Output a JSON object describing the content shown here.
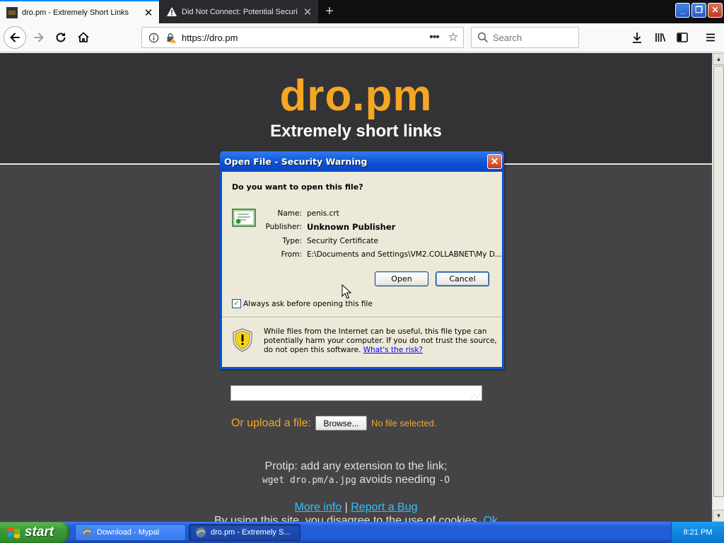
{
  "browser": {
    "tabs": [
      {
        "title": "dro.pm - Extremely Short Links",
        "active": true
      },
      {
        "title": "Did Not Connect: Potential Securi",
        "active": false
      }
    ],
    "url": "https://dro.pm",
    "search_placeholder": "Search"
  },
  "page": {
    "logo": "dro.pm",
    "tagline": "Extremely short links",
    "upload_label": "Or upload a file:",
    "browse_label": "Browse...",
    "no_file": "No file selected.",
    "protip_line1": "Protip: add any extension to the link;",
    "protip_code": "wget dro.pm/a.jpg",
    "protip_mid": " avoids needing ",
    "protip_flag": "-O",
    "more_info": "More info",
    "separator": " | ",
    "report_bug": "Report a Bug",
    "cookie_text": "By using this site, you disagree to the use of cookies. ",
    "cookie_ok": "Ok"
  },
  "dialog": {
    "title": "Open File - Security Warning",
    "question": "Do you want to open this file?",
    "labels": {
      "name": "Name:",
      "publisher": "Publisher:",
      "type": "Type:",
      "from": "From:"
    },
    "values": {
      "name": "penis.crt",
      "publisher": "Unknown Publisher",
      "type": "Security Certificate",
      "from": "E:\\Documents and Settings\\VM2.COLLABNET\\My D..."
    },
    "open_label": "Open",
    "cancel_label": "Cancel",
    "always_ask": "Always ask before opening this file",
    "always_ask_checked": true,
    "warning_text": "While files from the Internet can be useful, this file type can potentially harm your computer. If you do not trust the source, do not open this software. ",
    "risk_link": "What's the risk?"
  },
  "taskbar": {
    "start": "start",
    "tasks": [
      {
        "title": "Download - Mypal",
        "active": false
      },
      {
        "title": "dro.pm - Extremely S...",
        "active": true
      }
    ],
    "clock": "8:21 PM"
  },
  "colors": {
    "accent_orange": "#f5a623",
    "link_blue": "#2ec0ff",
    "xp_blue": "#0a54d8"
  }
}
